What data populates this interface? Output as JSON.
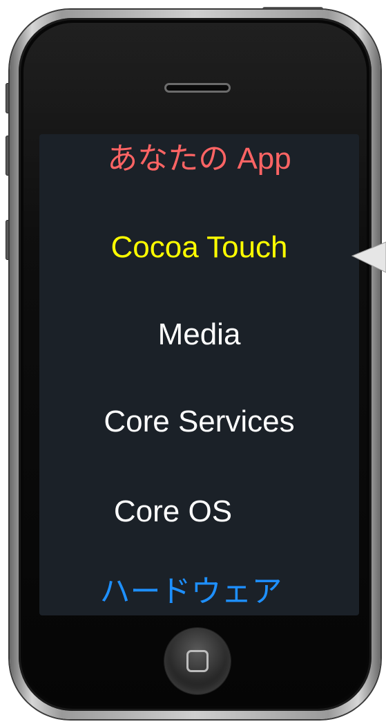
{
  "diagram": {
    "layers": [
      {
        "label": "あなたの App",
        "color": "#ff6464"
      },
      {
        "label": "Cocoa Touch",
        "color": "#ffff00"
      },
      {
        "label": "Media",
        "color": "#ffffff"
      },
      {
        "label": "Core Services",
        "color": "#ffffff"
      },
      {
        "label": "Core OS",
        "color": "#ffffff"
      },
      {
        "label": "ハードウェア",
        "color": "#1e90ff"
      }
    ]
  },
  "device": {
    "frame_icon": "iphone-frame",
    "home_button_icon": "home-square-icon",
    "pointer_icon": "pointer-arrow-icon"
  }
}
